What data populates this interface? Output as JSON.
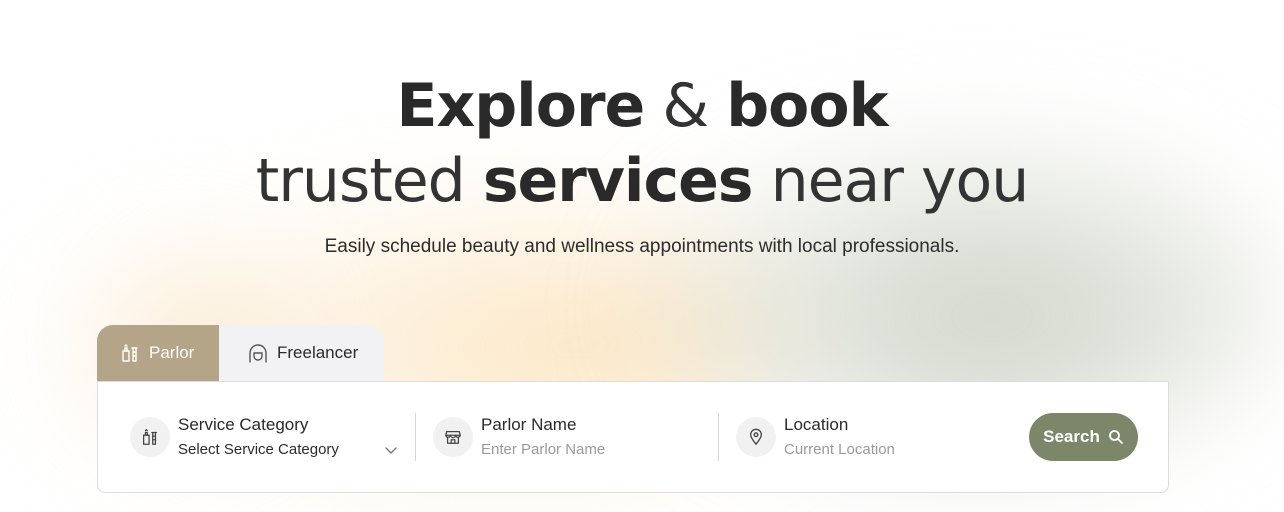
{
  "hero": {
    "line1_part1": "Explore",
    "line1_amp": "&",
    "line1_part2": "book",
    "line2_part1": "trusted",
    "line2_part2": "services",
    "line2_part3": "near you",
    "subtitle": "Easily schedule beauty and wellness appointments with local professionals."
  },
  "tabs": [
    {
      "label": "Parlor",
      "icon": "parlor-bottles-icon",
      "active": true
    },
    {
      "label": "Freelancer",
      "icon": "freelancer-person-icon",
      "active": false
    }
  ],
  "search": {
    "service": {
      "label": "Service Category",
      "value": "Select Service Category",
      "icon": "service-bottles-icon"
    },
    "parlor": {
      "label": "Parlor Name",
      "placeholder": "Enter Parlor Name",
      "icon": "storefront-icon"
    },
    "location": {
      "label": "Location",
      "placeholder": "Current Location",
      "icon": "location-pin-icon"
    },
    "button_label": "Search"
  },
  "colors": {
    "tab_active": "#b5a588",
    "tab_inactive": "#f2f2f4",
    "search_button": "#7c876a",
    "text_dark": "#2a2a2a",
    "placeholder": "#9a9a9a"
  }
}
